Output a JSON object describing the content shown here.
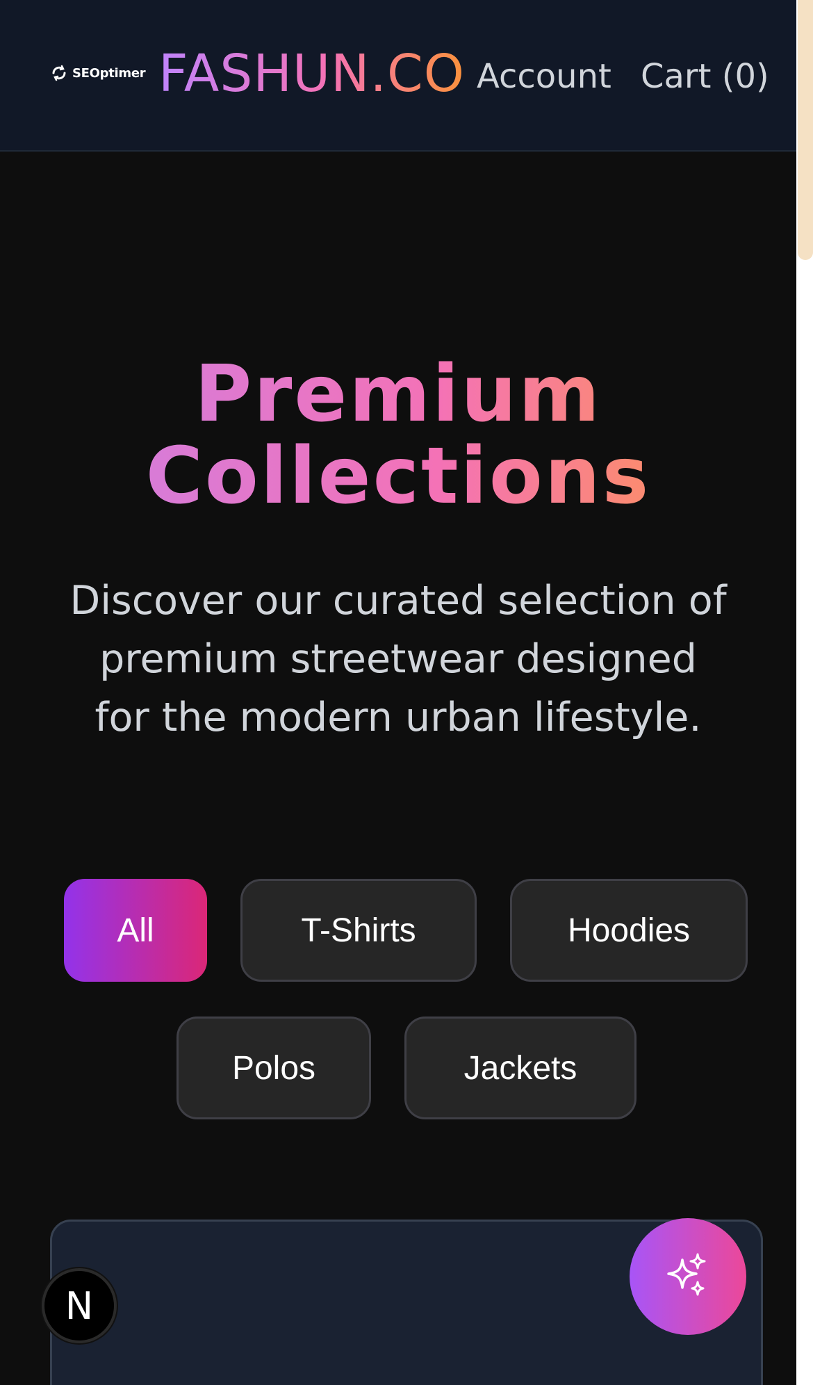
{
  "header": {
    "seo_badge": "SEOptimer",
    "brand": "FASHUN.CO",
    "nav": {
      "account": "Account",
      "cart": "Cart (0)"
    }
  },
  "hero": {
    "title_line1": "Premium",
    "title_line2": "Collections",
    "subtitle": "Discover our curated selection of premium streetwear designed for the modern urban lifestyle."
  },
  "filters": {
    "all": "All",
    "tshirts": "T-Shirts",
    "hoodies": "Hoodies",
    "polos": "Polos",
    "jackets": "Jackets",
    "selected": "All"
  },
  "floating": {
    "next_label": "N"
  },
  "colors": {
    "header_bg": "#111827",
    "page_bg": "#0e0e0e",
    "accent_start": "#9333ea",
    "accent_end": "#db2777"
  },
  "icons": {
    "seo": "seoptimer-logo-icon",
    "ai": "sparkles-icon",
    "next": "nextjs-icon"
  }
}
